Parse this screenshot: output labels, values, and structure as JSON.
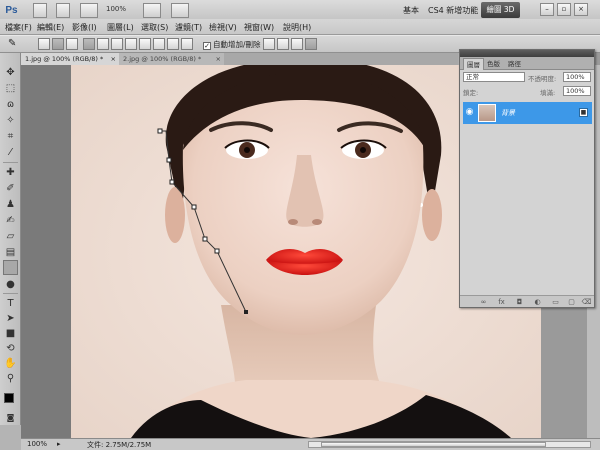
{
  "app": {
    "logo": "Ps",
    "zoom_top": "100%"
  },
  "menus": [
    "檔案(F)",
    "編輯(E)",
    "影像(I)",
    "圖層(L)",
    "選取(S)",
    "濾鏡(T)",
    "檢視(V)",
    "視窗(W)",
    "說明(H)"
  ],
  "workspaces": [
    "基本",
    "CS4 新增功能",
    "繪圖 3D"
  ],
  "options": {
    "auto_add_delete": "自動增加/刪除"
  },
  "tabs": [
    "1.jpg @ 100% (RGB/8) *",
    "2.jpg @ 100% (RGB/8) *"
  ],
  "status": {
    "zoom": "100%",
    "file": "文件: 2.75M/2.75M"
  },
  "layers_panel": {
    "tabs": [
      "圖層",
      "色版",
      "路徑"
    ],
    "blend_mode": "正常",
    "opacity_label": "不透明度:",
    "opacity_value": "100%",
    "lock_label": "鎖定:",
    "fill_label": "填滿:",
    "fill_value": "100%",
    "layer_name": "背景"
  },
  "colors": {
    "selection": "#3d98e8",
    "lip": "#d81818"
  }
}
